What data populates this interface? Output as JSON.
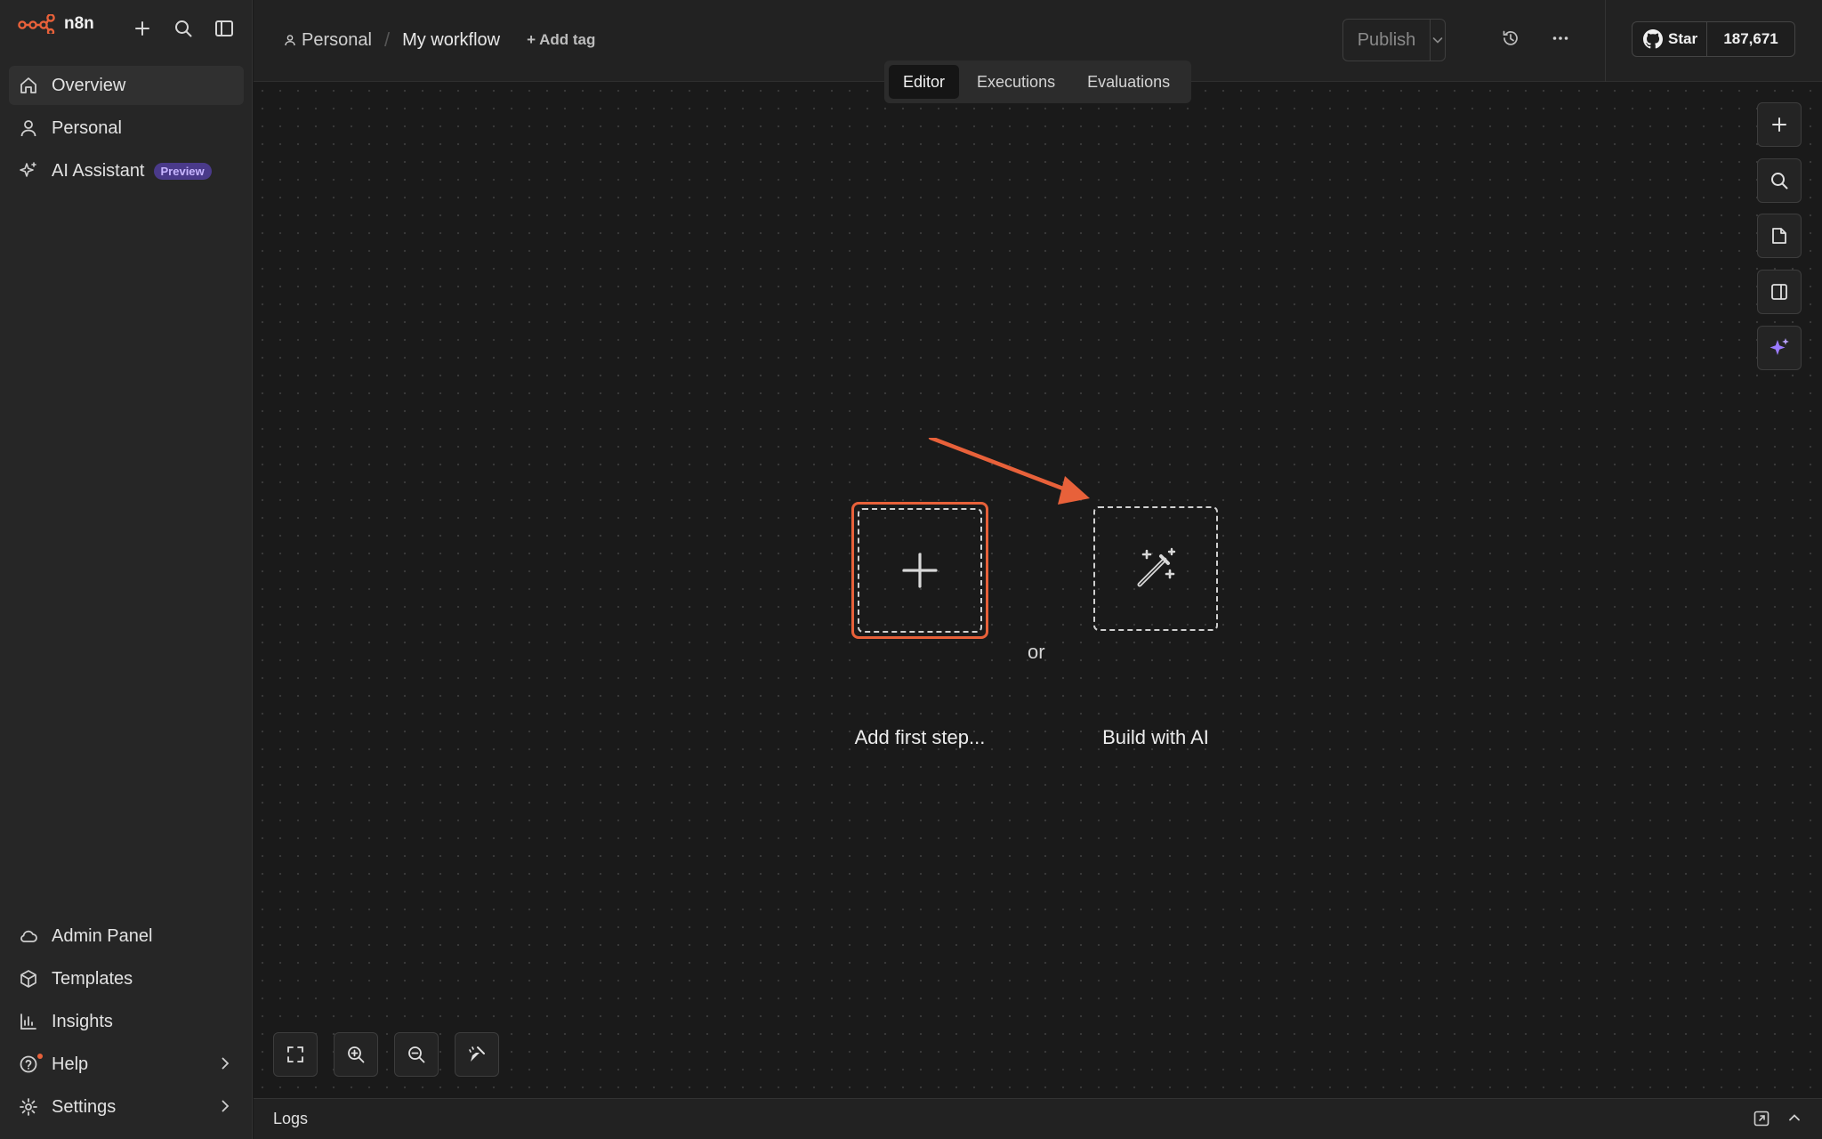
{
  "brand": {
    "name": "n8n",
    "accent": "#e8613a"
  },
  "sidebar": {
    "top_items": [
      {
        "label": "Overview",
        "icon": "home-icon",
        "active": true
      },
      {
        "label": "Personal",
        "icon": "user-icon"
      },
      {
        "label": "AI Assistant",
        "icon": "sparkle-icon",
        "badge": "Preview"
      }
    ],
    "bottom_items": [
      {
        "label": "Admin Panel",
        "icon": "cloud-icon"
      },
      {
        "label": "Templates",
        "icon": "box-icon"
      },
      {
        "label": "Insights",
        "icon": "bar-chart-icon"
      },
      {
        "label": "Help",
        "icon": "help-circle-icon"
      },
      {
        "label": "Settings",
        "icon": "gear-icon"
      }
    ]
  },
  "header": {
    "project": "Personal",
    "separator": "/",
    "workflow_name": "My workflow",
    "add_tag": "+ Add tag",
    "publish_label": "Publish",
    "github": {
      "star_label": "Star",
      "star_count": "187,671"
    }
  },
  "tabs": [
    {
      "label": "Editor",
      "active": true
    },
    {
      "label": "Executions"
    },
    {
      "label": "Evaluations"
    }
  ],
  "canvas": {
    "add_first_step": "Add first step...",
    "or": "or",
    "build_with_ai": "Build with AI"
  },
  "logs": {
    "label": "Logs"
  },
  "colors": {
    "background": "#1a1a1a",
    "sidebar": "#262626",
    "highlight": "#e8613a",
    "ai_purple": "#9b7bff"
  }
}
